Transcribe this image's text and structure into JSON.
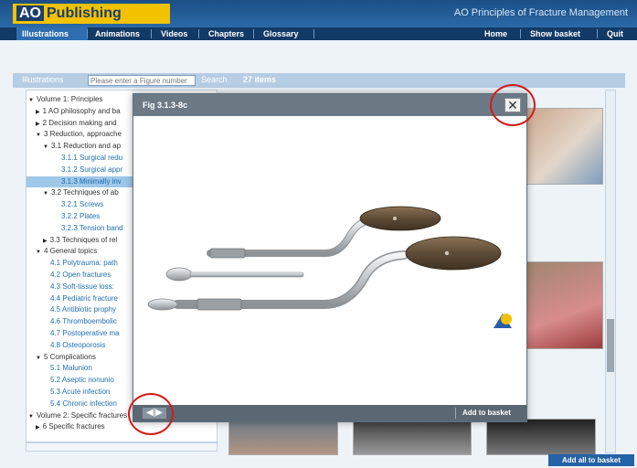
{
  "app": {
    "logo_prefix": "AO",
    "logo_text": "Publishing",
    "title": "AO Principles of Fracture Management"
  },
  "nav": {
    "left": [
      "Illustrations",
      "Animations",
      "Videos",
      "Chapters",
      "Glossary"
    ],
    "right": [
      "Home",
      "Show basket",
      "Quit"
    ]
  },
  "toolbar": {
    "tab_label": "Illustrations",
    "search_placeholder": "Please enter a Figure number",
    "search_label": "Search",
    "count": "27 items"
  },
  "tree": {
    "rows": [
      {
        "text": "Volume 1: Principles",
        "toggle": "▼"
      },
      {
        "text": "1 AO philosophy and ba",
        "toggle": "▶"
      },
      {
        "text": "2 Decision making and",
        "toggle": "▶"
      },
      {
        "text": "3 Reduction, approache",
        "toggle": "▼"
      },
      {
        "text": "3.1 Reduction and ap",
        "toggle": "▼"
      },
      {
        "text": "3.1.1 Surgical redu",
        "toggle": ""
      },
      {
        "text": "3.1.2 Surgical appr",
        "toggle": ""
      },
      {
        "text": "3.1.3 Minimally inv",
        "toggle": ""
      },
      {
        "text": "3.2 Techniques of ab",
        "toggle": "▼"
      },
      {
        "text": "3.2.1 Screws",
        "toggle": ""
      },
      {
        "text": "3.2.2 Plates",
        "toggle": ""
      },
      {
        "text": "3.2.3 Tension band",
        "toggle": ""
      },
      {
        "text": "3.3 Techniques of rel",
        "toggle": "▶"
      },
      {
        "text": "4 General topics",
        "toggle": "▼"
      },
      {
        "text": "4.1 Polytrauma: path",
        "toggle": ""
      },
      {
        "text": "4.2 Open fractures",
        "toggle": ""
      },
      {
        "text": "4.3 Soft-tissue loss:",
        "toggle": ""
      },
      {
        "text": "4.4 Pediatric fracture",
        "toggle": ""
      },
      {
        "text": "4.5 Antibiotic prophy",
        "toggle": ""
      },
      {
        "text": "4.6 Thromboembolic",
        "toggle": ""
      },
      {
        "text": "4.7 Postoperative ma",
        "toggle": ""
      },
      {
        "text": "4.8 Osteoporosis",
        "toggle": ""
      },
      {
        "text": "5 Complications",
        "toggle": "▼"
      },
      {
        "text": "5.1 Malunion",
        "toggle": ""
      },
      {
        "text": "5.2 Aseptic nonunio",
        "toggle": ""
      },
      {
        "text": "5.3 Acute infection",
        "toggle": ""
      },
      {
        "text": "5.4 Chronic infection",
        "toggle": ""
      },
      {
        "text": "Volume 2: Specific fractures",
        "toggle": "▼"
      },
      {
        "text": "6 Specific fractures",
        "toggle": "▶"
      }
    ]
  },
  "modal": {
    "title": "Fig 3.1.3-8c",
    "close_glyph": "✕",
    "pager_glyph": "◀|▶",
    "add_to_basket": "Add to basket"
  },
  "footer": {
    "add_all": "Add all to basket"
  },
  "colors": {
    "brand_blue": "#1c4e84",
    "logo_yellow": "#f2c200",
    "highlight_red": "#d21a1a"
  }
}
